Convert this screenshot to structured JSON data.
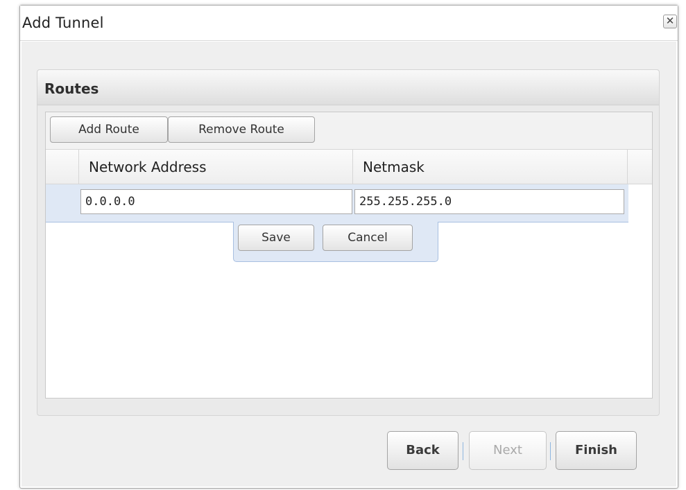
{
  "dialog": {
    "title": "Add Tunnel",
    "close_glyph": "✕"
  },
  "routes": {
    "title": "Routes",
    "toolbar": {
      "add_label": "Add Route",
      "remove_label": "Remove Route"
    },
    "columns": [
      "Network Address",
      "Netmask"
    ],
    "editor": {
      "network_address": "0.0.0.0",
      "netmask": "255.255.255.0",
      "save_label": "Save",
      "cancel_label": "Cancel"
    }
  },
  "footer": {
    "back_label": "Back",
    "next_label": "Next",
    "finish_label": "Finish"
  }
}
